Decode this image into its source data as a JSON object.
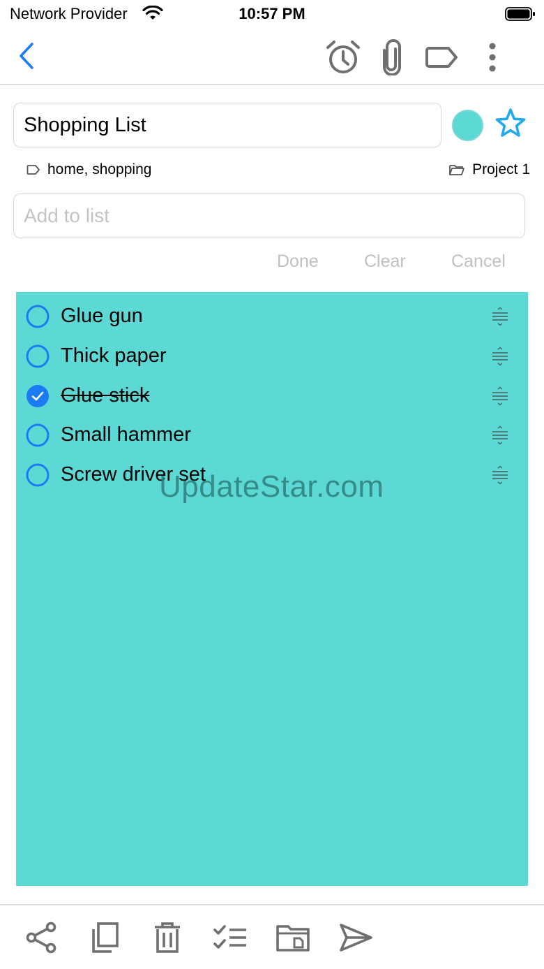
{
  "status_bar": {
    "carrier": "Network Provider",
    "time": "10:57 PM"
  },
  "nav": {
    "icons": [
      "back-chevron-icon",
      "alarm-clock-icon",
      "paperclip-icon",
      "tag-icon",
      "more-vertical-icon"
    ],
    "accent_color": "#1a7cf0"
  },
  "note": {
    "title": "Shopping List",
    "color": "#5dd9d5",
    "starred": false,
    "tags": "home, shopping",
    "project": "Project 1"
  },
  "add_item": {
    "placeholder": "Add to list",
    "value": ""
  },
  "actions": {
    "done": "Done",
    "clear": "Clear",
    "cancel": "Cancel"
  },
  "checklist": {
    "items": [
      {
        "label": "Glue gun",
        "checked": false
      },
      {
        "label": "Thick paper",
        "checked": false
      },
      {
        "label": "Glue stick",
        "checked": true
      },
      {
        "label": "Small hammer",
        "checked": false
      },
      {
        "label": "Screw driver set",
        "checked": false
      }
    ]
  },
  "watermark": "UpdateStar.com",
  "toolbar": {
    "icons": [
      "share-icon",
      "copy-icon",
      "trash-icon",
      "checklist-icon",
      "folder-icon",
      "send-icon"
    ]
  }
}
